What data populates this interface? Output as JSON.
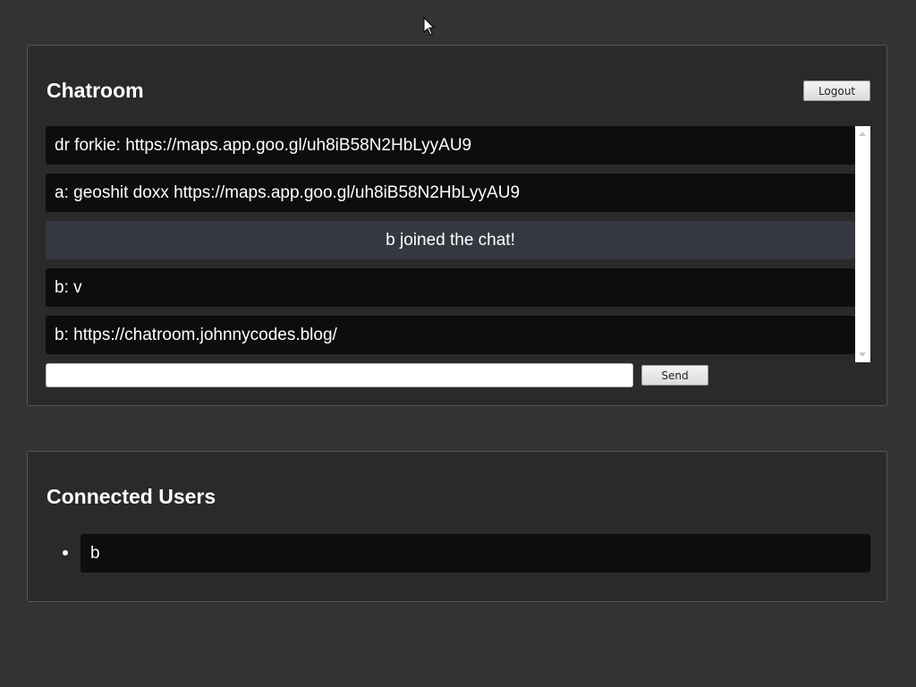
{
  "chat": {
    "title": "Chatroom",
    "logout_label": "Logout",
    "messages": [
      {
        "text": "dr forkie: https://maps.app.goo.gl/uh8iB58N2HbLyyAU9",
        "kind": "user"
      },
      {
        "text": "a: geoshit doxx https://maps.app.goo.gl/uh8iB58N2HbLyyAU9",
        "kind": "user"
      },
      {
        "text": "b joined the chat!",
        "kind": "system"
      },
      {
        "text": "b: v",
        "kind": "user"
      },
      {
        "text": "b: https://chatroom.johnnycodes.blog/",
        "kind": "user"
      }
    ],
    "input": {
      "value": "",
      "placeholder": ""
    },
    "send_label": "Send"
  },
  "users": {
    "title": "Connected Users",
    "list": [
      "b"
    ]
  },
  "colors": {
    "background": "#333333",
    "panel": "#2a2a2a",
    "message_bg": "#0d0d0d",
    "system_message_bg": "#353840"
  }
}
